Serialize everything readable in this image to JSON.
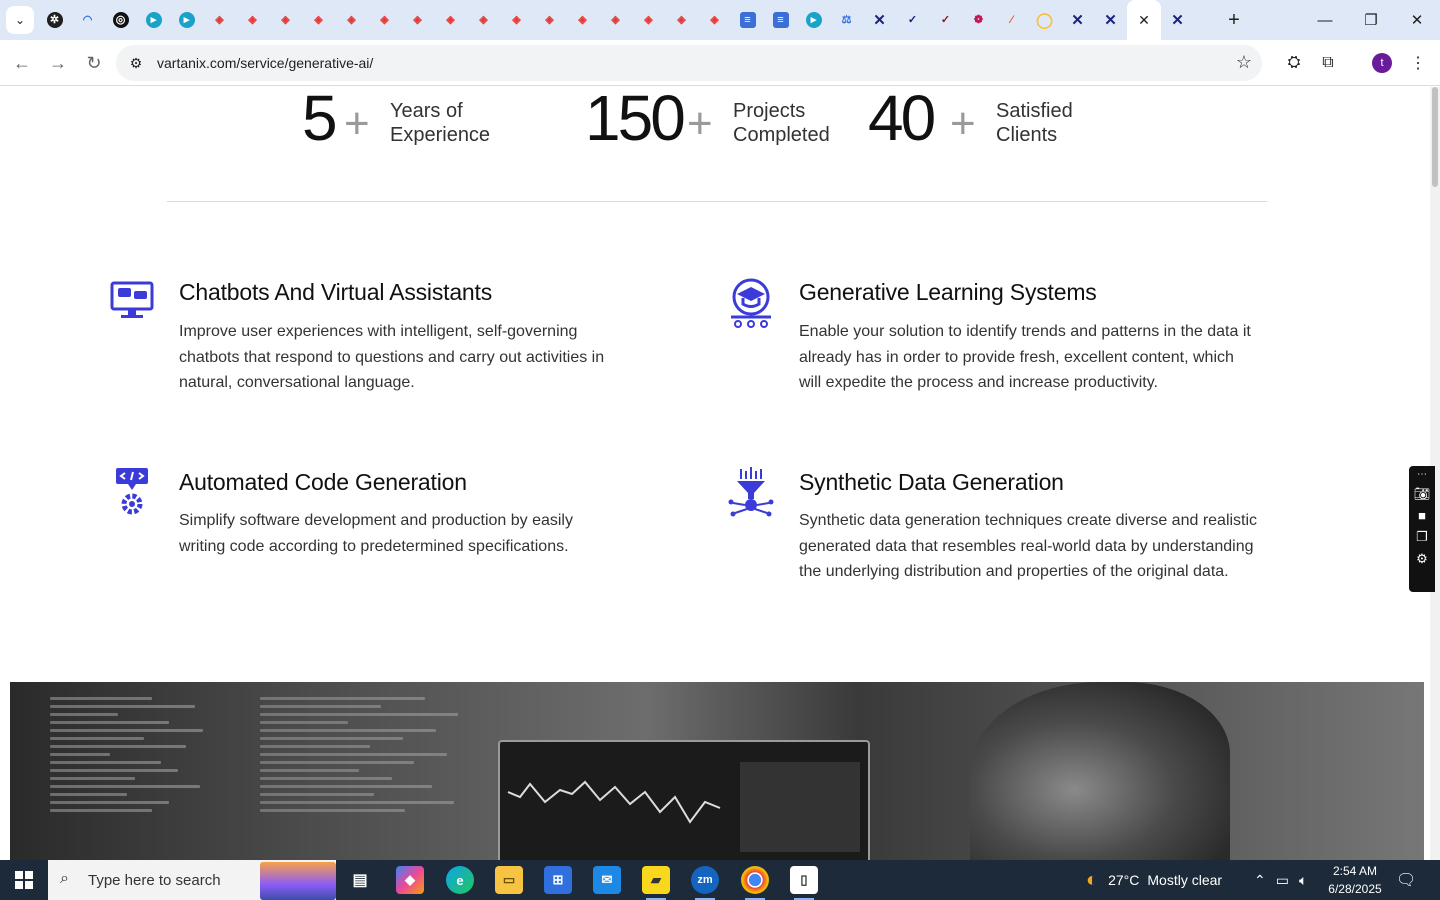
{
  "browser": {
    "tab_favicons": [
      "gear",
      "arc",
      "dot",
      "play",
      "play",
      "gem",
      "gem",
      "gem",
      "gem",
      "gem",
      "gem",
      "gem",
      "gem",
      "gem",
      "gem",
      "gem",
      "gem",
      "gem",
      "gem",
      "gem",
      "gem",
      "doc",
      "doc",
      "play",
      "scale",
      "x",
      "check",
      "check",
      "swirl",
      "slash",
      "ring",
      "x",
      "x",
      "active-close",
      "x"
    ],
    "active_tab_close": "✕",
    "new_tab": "+",
    "url": "vartanix.com/service/generative-ai/",
    "profile_initial": "t"
  },
  "stats": [
    {
      "number": "5",
      "plus": "+",
      "label": "Years of Experience"
    },
    {
      "number": "150",
      "plus": "+",
      "label": "Projects Completed"
    },
    {
      "number": "40",
      "plus": "+",
      "label": "Satisfied Clients"
    }
  ],
  "features": [
    {
      "title": "Chatbots And Virtual Assistants",
      "text": "Improve user experiences with intelligent, self-governing chatbots that respond to questions and carry out activities in natural, conversational language.",
      "icon": "chatbot-monitor-icon"
    },
    {
      "title": "Generative Learning Systems",
      "text": "Enable your solution to identify trends and patterns in the data it already has in order to provide fresh, excellent content, which will expedite the process and increase productivity.",
      "icon": "graduation-brain-icon"
    },
    {
      "title": "Automated Code Generation",
      "text": "Simplify software development and production by easily writing code according to predetermined specifications.",
      "icon": "code-gear-icon"
    },
    {
      "title": "Synthetic Data Generation",
      "text": "Synthetic data generation techniques create diverse and realistic generated data that resembles real-world data by understanding the underlying distribution and properties of the original data.",
      "icon": "data-funnel-icon"
    }
  ],
  "colors": {
    "accent": "#3b3bd9",
    "text": "#111111",
    "muted": "#9a9a9a"
  },
  "taskbar": {
    "search_placeholder": "Type here to search",
    "weather_temp": "27°C",
    "weather_desc": "Mostly clear",
    "time": "2:54 AM",
    "date": "6/28/2025"
  }
}
